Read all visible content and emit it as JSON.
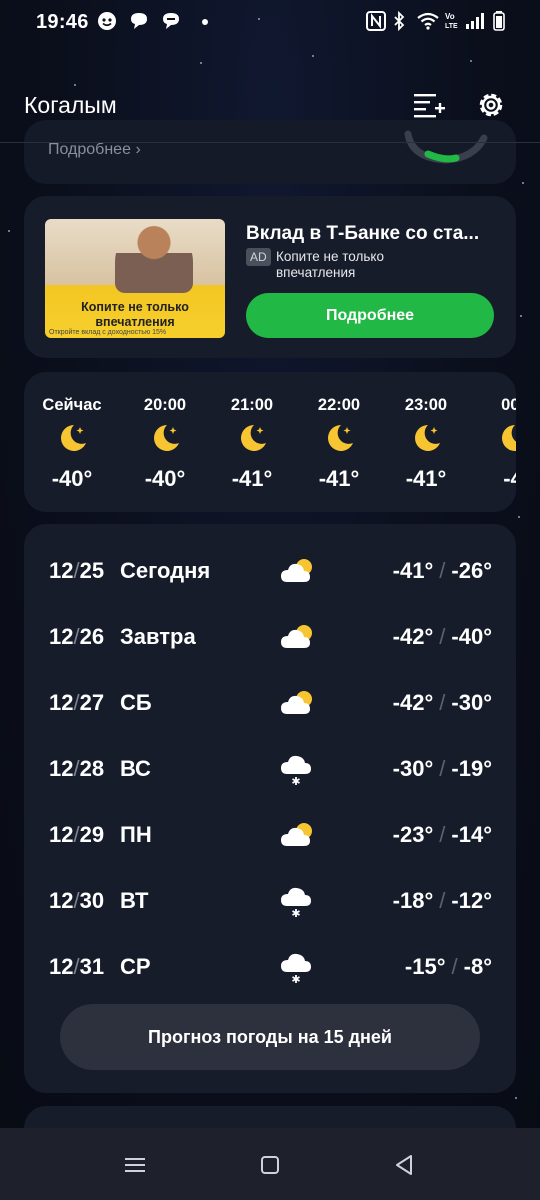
{
  "status_bar": {
    "time": "19:46"
  },
  "header": {
    "city": "Когалым"
  },
  "partial_card": {
    "more_label": "Подробнее"
  },
  "ad": {
    "title": "Вклад в Т-Банке со ста...",
    "badge": "AD",
    "text": "Копите не только впечатления",
    "image_caption": "Копите не только впечатления",
    "image_small": "Откройте вклад с доходностью 15%",
    "button_label": "Подробнее"
  },
  "hourly": [
    {
      "time": "Сейчас",
      "icon": "moon-icon",
      "temp": "-40°"
    },
    {
      "time": "20:00",
      "icon": "moon-icon",
      "temp": "-40°"
    },
    {
      "time": "21:00",
      "icon": "moon-icon",
      "temp": "-41°"
    },
    {
      "time": "22:00",
      "icon": "moon-icon",
      "temp": "-41°"
    },
    {
      "time": "23:00",
      "icon": "moon-icon",
      "temp": "-41°"
    },
    {
      "time": "00:",
      "icon": "moon-icon",
      "temp": "-4"
    }
  ],
  "daily": [
    {
      "month": "12",
      "date": "25",
      "day": "Сегодня",
      "icon": "partly-cloudy-icon",
      "low": "-41°",
      "high": "-26°"
    },
    {
      "month": "12",
      "date": "26",
      "day": "Завтра",
      "icon": "partly-cloudy-icon",
      "low": "-42°",
      "high": "-40°"
    },
    {
      "month": "12",
      "date": "27",
      "day": "СБ",
      "icon": "partly-cloudy-icon",
      "low": "-42°",
      "high": "-30°"
    },
    {
      "month": "12",
      "date": "28",
      "day": "ВС",
      "icon": "snow-icon",
      "low": "-30°",
      "high": "-19°"
    },
    {
      "month": "12",
      "date": "29",
      "day": "ПН",
      "icon": "partly-cloudy-icon",
      "low": "-23°",
      "high": "-14°"
    },
    {
      "month": "12",
      "date": "30",
      "day": "ВТ",
      "icon": "snow-icon",
      "low": "-18°",
      "high": "-12°"
    },
    {
      "month": "12",
      "date": "31",
      "day": "СР",
      "icon": "snow-icon",
      "low": "-15°",
      "high": "-8°"
    }
  ],
  "forecast_button": "Прогноз погоды на 15 дней",
  "colors": {
    "accent_green": "#21b845",
    "card_bg": "#161c2a",
    "moon": "#f7c531"
  }
}
